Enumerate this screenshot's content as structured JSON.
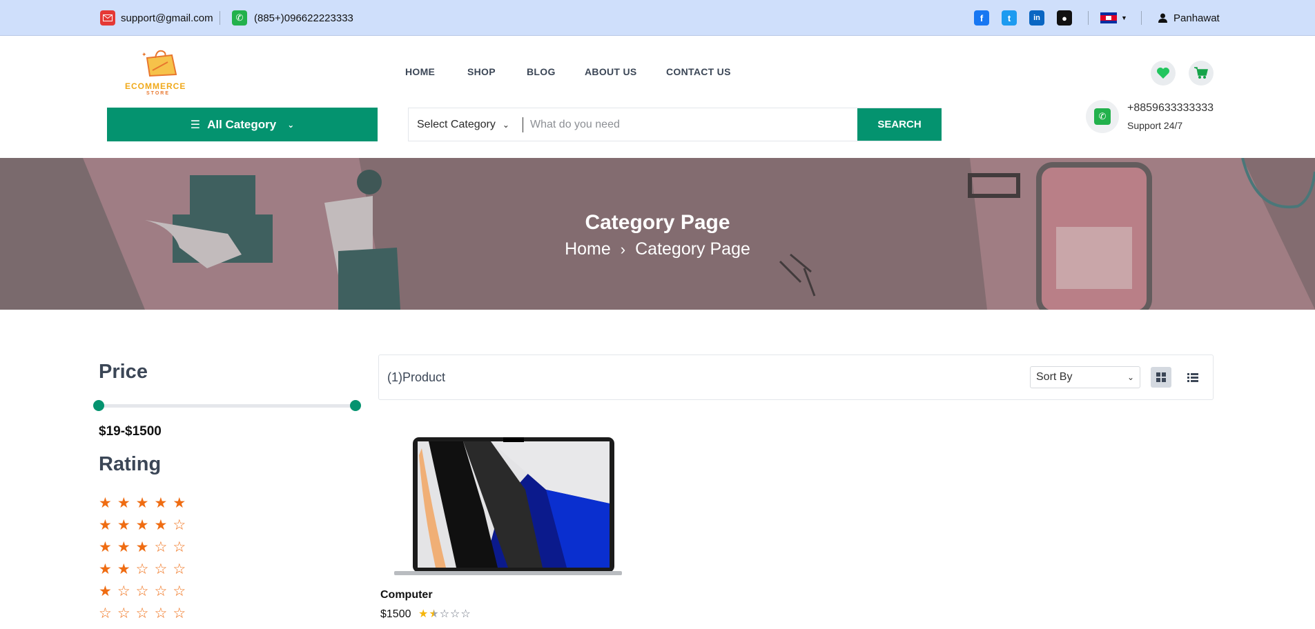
{
  "topbar": {
    "email": "support@gmail.com",
    "phone": "(885+)096622223333",
    "user": "Panhawat",
    "socials": [
      "facebook-icon",
      "twitter-icon",
      "linkedin-icon",
      "github-icon"
    ]
  },
  "brand": {
    "logo_text": "ECOMMERCE",
    "logo_sub": "STORE"
  },
  "nav": {
    "items": [
      "HOME",
      "SHOP",
      "BLOG",
      "ABOUT US",
      "CONTACT US"
    ]
  },
  "all_category": {
    "label": "All Category"
  },
  "search": {
    "category_label": "Select Category",
    "placeholder": "What do you need",
    "button": "SEARCH"
  },
  "support": {
    "phone": "+8859633333333",
    "label": "Support 24/7"
  },
  "banner": {
    "title": "Category Page",
    "breadcrumb": [
      "Home",
      "Category Page"
    ]
  },
  "sidebar": {
    "price_heading": "Price",
    "price_range": "$19-$1500",
    "price_min_fraction": 0,
    "price_max_fraction": 1,
    "rating_heading": "Rating",
    "rating_levels": [
      5,
      4,
      3,
      2,
      1,
      0
    ]
  },
  "products_bar": {
    "count_label": "(1)Product",
    "sort_label": "Sort By",
    "active_view": "grid"
  },
  "products": [
    {
      "name": "Computer",
      "price": "$1500",
      "rating": 1.5
    }
  ],
  "colors": {
    "accent": "#04936f",
    "star": "#ef6c12",
    "topbar": "#cfdffb"
  }
}
